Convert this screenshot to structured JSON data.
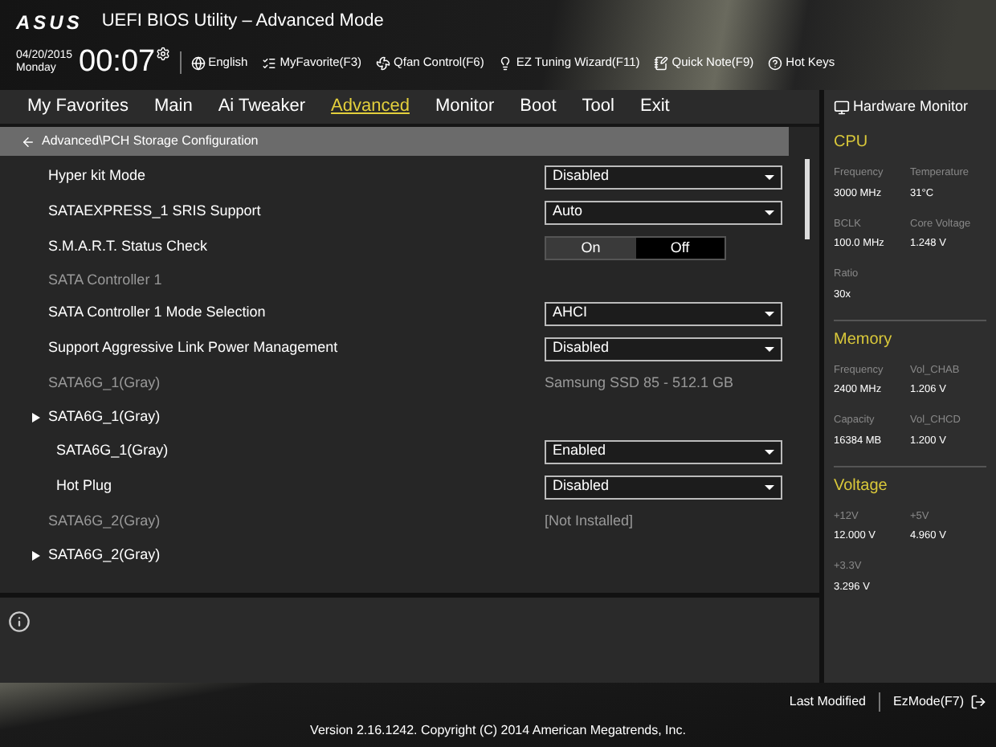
{
  "header": {
    "logo": "ASUS",
    "title": "UEFI BIOS Utility – Advanced Mode",
    "date": "04/20/2015",
    "day": "Monday",
    "time": "00:07",
    "tools": [
      {
        "kind": "globe",
        "label": "English"
      },
      {
        "kind": "favorite",
        "label": "MyFavorite(F3)"
      },
      {
        "kind": "fan",
        "label": "Qfan Control(F6)"
      },
      {
        "kind": "bulb",
        "label": "EZ Tuning Wizard(F11)"
      },
      {
        "kind": "note",
        "label": "Quick Note(F9)"
      },
      {
        "kind": "help",
        "label": "Hot Keys"
      }
    ]
  },
  "tabs": [
    {
      "label": "My Favorites",
      "selected": false
    },
    {
      "label": "Main",
      "selected": false
    },
    {
      "label": "Ai Tweaker",
      "selected": false
    },
    {
      "label": "Advanced",
      "selected": true
    },
    {
      "label": "Monitor",
      "selected": false
    },
    {
      "label": "Boot",
      "selected": false
    },
    {
      "label": "Tool",
      "selected": false
    },
    {
      "label": "Exit",
      "selected": false
    }
  ],
  "breadcrumb": "Advanced\\PCH Storage Configuration",
  "settings": [
    {
      "kind": "select",
      "label": "Hyper kit Mode",
      "value": "Disabled"
    },
    {
      "kind": "select",
      "label": "SATAEXPRESS_1 SRIS Support",
      "value": "Auto"
    },
    {
      "kind": "toggle",
      "label": "S.M.A.R.T. Status Check",
      "options": [
        {
          "label": "On",
          "selected": false
        },
        {
          "label": "Off",
          "selected": true
        }
      ]
    },
    {
      "kind": "label",
      "label": "SATA Controller 1"
    },
    {
      "kind": "select",
      "label": "SATA Controller 1 Mode Selection",
      "value": "AHCI"
    },
    {
      "kind": "select",
      "label": "Support Aggressive Link Power Management",
      "value": "Disabled"
    },
    {
      "kind": "info",
      "label": "SATA6G_1(Gray)",
      "value": "Samsung SSD 85 - 512.1 GB"
    },
    {
      "kind": "submenu",
      "label": "SATA6G_1(Gray)",
      "children": [
        {
          "kind": "select",
          "label": "SATA6G_1(Gray)",
          "value": "Enabled"
        },
        {
          "kind": "select",
          "label": "Hot Plug",
          "value": "Disabled"
        }
      ]
    },
    {
      "kind": "info",
      "label": "SATA6G_2(Gray)",
      "value": "[Not Installed]"
    },
    {
      "kind": "submenu",
      "label": "SATA6G_2(Gray)"
    }
  ],
  "hardware_monitor": {
    "title": "Hardware Monitor",
    "sections": [
      {
        "title": "CPU",
        "items": [
          {
            "label": "Frequency",
            "value": "3000 MHz"
          },
          {
            "label": "Temperature",
            "value": "31°C"
          },
          {
            "label": "BCLK",
            "value": "100.0 MHz"
          },
          {
            "label": "Core Voltage",
            "value": "1.248 V"
          },
          {
            "label": "Ratio",
            "value": "30x"
          }
        ]
      },
      {
        "title": "Memory",
        "items": [
          {
            "label": "Frequency",
            "value": "2400 MHz"
          },
          {
            "label": "Vol_CHAB",
            "value": "1.206 V"
          },
          {
            "label": "Capacity",
            "value": "16384 MB"
          },
          {
            "label": "Vol_CHCD",
            "value": "1.200 V"
          }
        ]
      },
      {
        "title": "Voltage",
        "items": [
          {
            "label": "+12V",
            "value": "12.000 V"
          },
          {
            "label": "+5V",
            "value": "4.960 V"
          },
          {
            "label": "+3.3V",
            "value": "3.296 V"
          }
        ]
      }
    ]
  },
  "footer": {
    "last_modified": "Last Modified",
    "ez_mode": "EzMode(F7)",
    "version": "Version 2.16.1242. Copyright (C) 2014 American Megatrends, Inc."
  }
}
